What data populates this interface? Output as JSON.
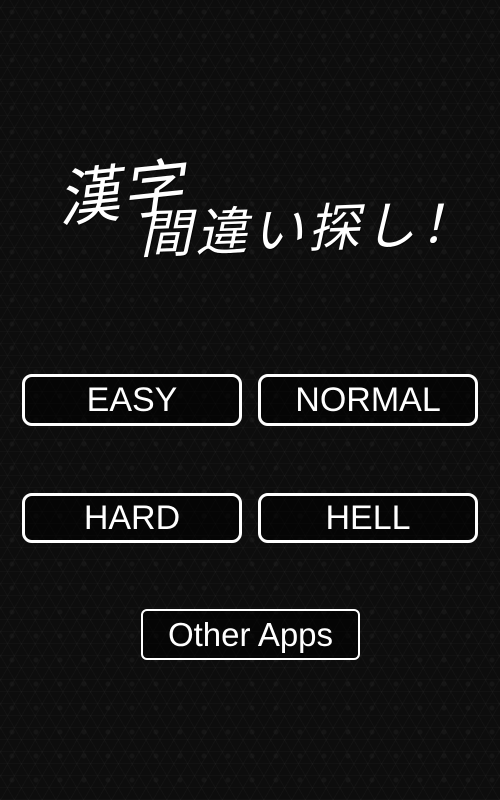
{
  "title": {
    "line1": "漢字",
    "line2": "間違い探し！"
  },
  "buttons": {
    "easy": "EASY",
    "normal": "NORMAL",
    "hard": "HARD",
    "hell": "HELL",
    "other_apps": "Other Apps"
  },
  "colors": {
    "background": "#0d0d0d",
    "text": "#ffffff",
    "button_border": "#ffffff"
  }
}
